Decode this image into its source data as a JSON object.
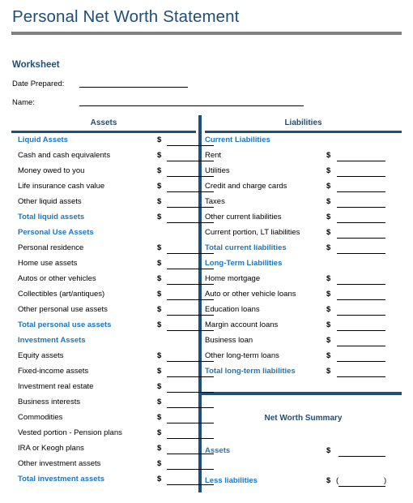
{
  "document": {
    "title": "Personal Net Worth Statement",
    "section_heading": "Worksheet"
  },
  "form": {
    "date_prepared_label": "Date Prepared:",
    "date_prepared_value": "",
    "name_label": "Name:",
    "name_value": ""
  },
  "columns": {
    "assets_header": "Assets",
    "liabilities_header": "Liabilities"
  },
  "colors": {
    "title_navy": "#1F4E79",
    "section_blue": "#1F76BC",
    "rule_gray": "#808080",
    "divider_navy": "#1F4E79"
  },
  "assets": {
    "rows": [
      {
        "label": "Liquid Assets",
        "kind": "section",
        "amount": "",
        "has_amount": true
      },
      {
        "label": "Cash and cash equivalents",
        "kind": "item",
        "amount": "",
        "has_amount": true
      },
      {
        "label": "Money owed to you",
        "kind": "item",
        "amount": "",
        "has_amount": true
      },
      {
        "label": "Life insurance cash value",
        "kind": "item",
        "amount": "",
        "has_amount": true
      },
      {
        "label": "Other liquid assets",
        "kind": "item",
        "amount": "",
        "has_amount": true
      },
      {
        "label": "Total liquid assets",
        "kind": "total",
        "amount": "",
        "has_amount": true
      },
      {
        "label": "Personal Use Assets",
        "kind": "section",
        "amount": "",
        "has_amount": false
      },
      {
        "label": "Personal residence",
        "kind": "item",
        "amount": "",
        "has_amount": true
      },
      {
        "label": "Home use assets",
        "kind": "item",
        "amount": "",
        "has_amount": true
      },
      {
        "label": "Autos or other vehicles",
        "kind": "item",
        "amount": "",
        "has_amount": true
      },
      {
        "label": "Collectibles (art/antiques)",
        "kind": "item",
        "amount": "",
        "has_amount": true
      },
      {
        "label": "Other personal use assets",
        "kind": "item",
        "amount": "",
        "has_amount": true
      },
      {
        "label": "Total personal use assets",
        "kind": "total",
        "amount": "",
        "has_amount": true
      },
      {
        "label": "Investment Assets",
        "kind": "section",
        "amount": "",
        "has_amount": false
      },
      {
        "label": "Equity assets",
        "kind": "item",
        "amount": "",
        "has_amount": true
      },
      {
        "label": "Fixed-income assets",
        "kind": "item",
        "amount": "",
        "has_amount": true
      },
      {
        "label": "Investment real estate",
        "kind": "item",
        "amount": "",
        "has_amount": true
      },
      {
        "label": "Business interests",
        "kind": "item",
        "amount": "",
        "has_amount": true
      },
      {
        "label": "Commodities",
        "kind": "item",
        "amount": "",
        "has_amount": true
      },
      {
        "label": "Vested portion - Pension plans",
        "kind": "item",
        "amount": "",
        "has_amount": true
      },
      {
        "label": "IRA or Keogh plans",
        "kind": "item",
        "amount": "",
        "has_amount": true
      },
      {
        "label": "Other investment assets",
        "kind": "item",
        "amount": "",
        "has_amount": true
      },
      {
        "label": "Total investment assets",
        "kind": "total",
        "amount": "",
        "has_amount": true
      }
    ]
  },
  "liabilities": {
    "rows": [
      {
        "label": "Current Liabilities",
        "kind": "section",
        "amount": "",
        "has_amount": false
      },
      {
        "label": "Rent",
        "kind": "item",
        "amount": "",
        "has_amount": true
      },
      {
        "label": "Utilities",
        "kind": "item",
        "amount": "",
        "has_amount": true
      },
      {
        "label": "Credit and charge cards",
        "kind": "item",
        "amount": "",
        "has_amount": true
      },
      {
        "label": "Taxes",
        "kind": "item",
        "amount": "",
        "has_amount": true
      },
      {
        "label": "Other current liabilities",
        "kind": "item",
        "amount": "",
        "has_amount": true
      },
      {
        "label": "Current portion, LT liabilities",
        "kind": "item",
        "amount": "",
        "has_amount": true
      },
      {
        "label": "Total current liabilities",
        "kind": "total",
        "amount": "",
        "has_amount": true
      },
      {
        "label": "Long-Term Liabilities",
        "kind": "section",
        "amount": "",
        "has_amount": false
      },
      {
        "label": "Home mortgage",
        "kind": "item",
        "amount": "",
        "has_amount": true
      },
      {
        "label": "Auto or other vehicle loans",
        "kind": "item",
        "amount": "",
        "has_amount": true
      },
      {
        "label": "Education loans",
        "kind": "item",
        "amount": "",
        "has_amount": true
      },
      {
        "label": "Margin account loans",
        "kind": "item",
        "amount": "",
        "has_amount": true
      },
      {
        "label": "Business loan",
        "kind": "item",
        "amount": "",
        "has_amount": true
      },
      {
        "label": "Other long-term loans",
        "kind": "item",
        "amount": "",
        "has_amount": true
      },
      {
        "label": "Total long-term liabilities",
        "kind": "total",
        "amount": "",
        "has_amount": true
      }
    ]
  },
  "net_worth_summary": {
    "title": "Net Worth Summary",
    "rows": [
      {
        "label": "Assets",
        "amount": "",
        "parenthesized": false
      },
      {
        "label": "Less liabilities",
        "amount": "",
        "parenthesized": true
      }
    ]
  },
  "symbols": {
    "currency": "$",
    "paren_open": "(",
    "paren_close": ")"
  }
}
